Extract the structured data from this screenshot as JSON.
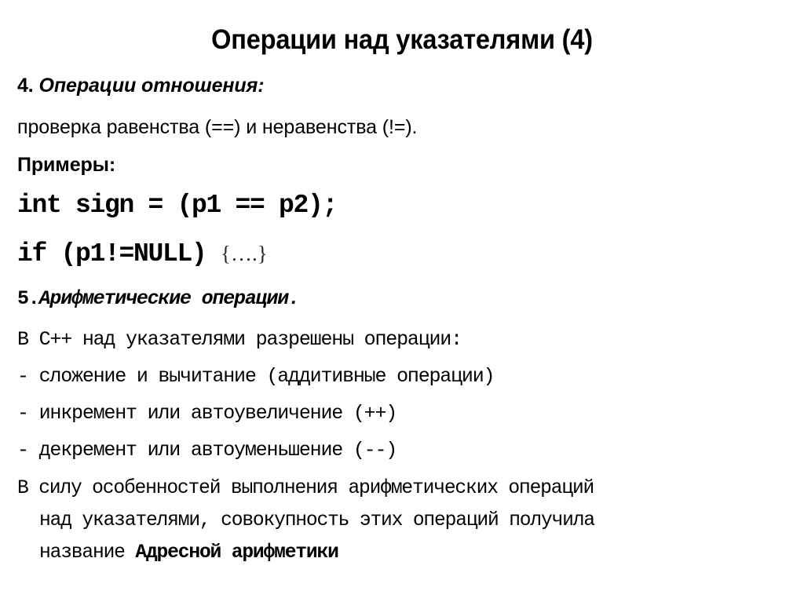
{
  "slide": {
    "title": "Операции над указателями (4)",
    "sections": [
      {
        "id": "relational-ops",
        "number": "4. ",
        "heading": "Операции отношения:",
        "description": "проверка равенства (==) и неравенства (!=).",
        "examples_label": "Примеры:",
        "code_lines": [
          {
            "text": "int sign = (p1 == p2);",
            "trailing": ""
          },
          {
            "text": "if (p1!=NULL) ",
            "trailing": "{….}"
          }
        ]
      },
      {
        "id": "arithmetic-ops",
        "number": "5.",
        "heading": "Арифметические операции.",
        "intro": "В C++ над указателями разрешены операции:",
        "bullets": [
          "- сложение и вычитание (аддитивные операции)",
          "- инкремент или автоувеличение (++)",
          "- декремент или автоуменьшение (--)"
        ],
        "closing_paragraph": {
          "line1": "В силу особенностей выполнения арифметических операций",
          "line2": "над указателями, совокупность этих операций получила",
          "line3_prefix": "название ",
          "line3_bold": "Адресной арифметики"
        }
      }
    ]
  },
  "colors": {
    "background": "#ffffff",
    "text": "#000000",
    "dim_text": "#2b2b2b"
  }
}
